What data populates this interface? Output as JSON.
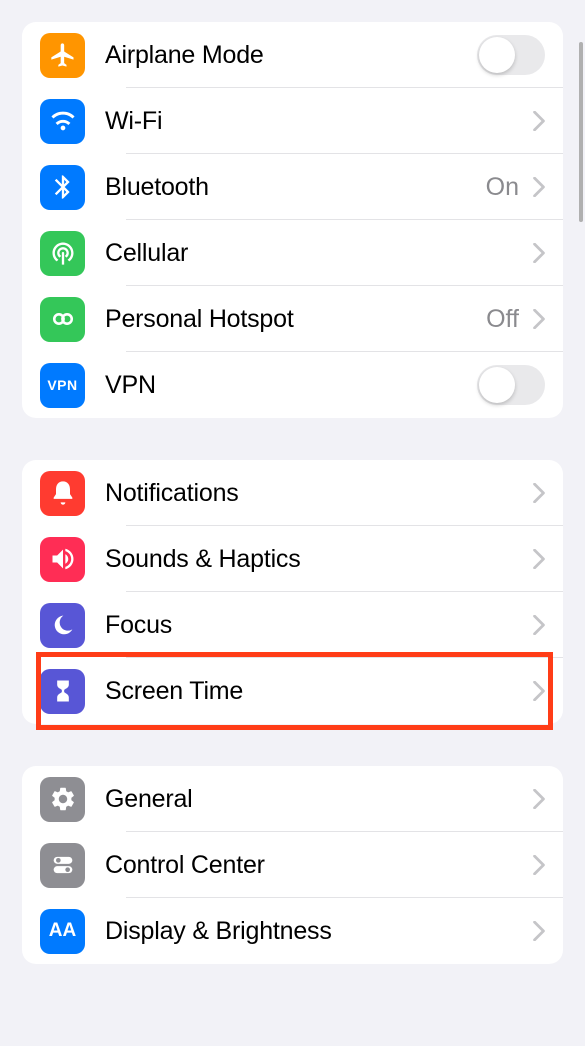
{
  "groups": [
    {
      "id": "connectivity",
      "items": [
        {
          "id": "airplane",
          "label": "Airplane Mode",
          "icon": "airplane-icon",
          "color": "c-orange",
          "type": "toggle",
          "toggled": false
        },
        {
          "id": "wifi",
          "label": "Wi-Fi",
          "icon": "wifi-icon",
          "color": "c-blue",
          "type": "nav",
          "value": ""
        },
        {
          "id": "bluetooth",
          "label": "Bluetooth",
          "icon": "bluetooth-icon",
          "color": "c-blue",
          "type": "nav",
          "value": "On"
        },
        {
          "id": "cellular",
          "label": "Cellular",
          "icon": "cellular-icon",
          "color": "c-green",
          "type": "nav",
          "value": ""
        },
        {
          "id": "hotspot",
          "label": "Personal Hotspot",
          "icon": "hotspot-icon",
          "color": "c-green",
          "type": "nav",
          "value": "Off"
        },
        {
          "id": "vpn",
          "label": "VPN",
          "icon": "vpn-icon",
          "color": "c-blue",
          "type": "toggle",
          "toggled": false
        }
      ]
    },
    {
      "id": "attention",
      "items": [
        {
          "id": "notifications",
          "label": "Notifications",
          "icon": "bell-icon",
          "color": "c-red",
          "type": "nav"
        },
        {
          "id": "sounds",
          "label": "Sounds & Haptics",
          "icon": "speaker-icon",
          "color": "c-pink",
          "type": "nav"
        },
        {
          "id": "focus",
          "label": "Focus",
          "icon": "moon-icon",
          "color": "c-indigo",
          "type": "nav"
        },
        {
          "id": "screentime",
          "label": "Screen Time",
          "icon": "hourglass-icon",
          "color": "c-indigo",
          "type": "nav",
          "highlighted": true
        }
      ]
    },
    {
      "id": "device",
      "items": [
        {
          "id": "general",
          "label": "General",
          "icon": "gear-icon",
          "color": "c-gray",
          "type": "nav"
        },
        {
          "id": "controlcenter",
          "label": "Control Center",
          "icon": "switches-icon",
          "color": "c-gray",
          "type": "nav"
        },
        {
          "id": "display",
          "label": "Display & Brightness",
          "icon": "aa-icon",
          "color": "c-blue",
          "type": "nav"
        }
      ]
    }
  ]
}
